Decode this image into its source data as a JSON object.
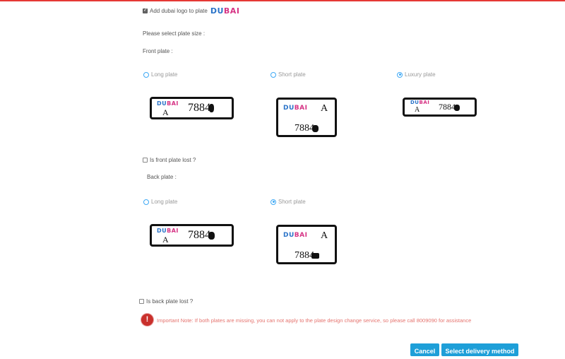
{
  "logo_option": {
    "label": "Add dubai logo to plate",
    "checked": true
  },
  "logo": {
    "part1": "DU",
    "part2": "BAI",
    "color_primary": "#2a73c8",
    "color_accent": "#d63384"
  },
  "select_size": "Please select plate size :",
  "front": {
    "title": "Front plate :",
    "options": [
      {
        "label": "Long plate",
        "selected": false
      },
      {
        "label": "Short plate",
        "selected": false
      },
      {
        "label": "Luxury plate",
        "selected": true
      }
    ],
    "lost_label": "Is front plate lost ?",
    "lost_checked": false
  },
  "back": {
    "title": "Back plate :",
    "options": [
      {
        "label": "Long plate",
        "selected": false
      },
      {
        "label": "Short plate",
        "selected": true
      }
    ],
    "lost_label": "Is back plate lost ?",
    "lost_checked": false
  },
  "plate": {
    "letter": "A",
    "number": "7884"
  },
  "note": "Important Note: If both plates are missing, you can not apply to the plate design change service, so please call 8009090 for assistance",
  "buttons": {
    "cancel": "Cancel",
    "next": "Select delivery method"
  },
  "colors": {
    "accent": "#3fa9f5",
    "button": "#1e9fd8",
    "warning": "#c9302c",
    "warning_text": "#e5736e"
  }
}
